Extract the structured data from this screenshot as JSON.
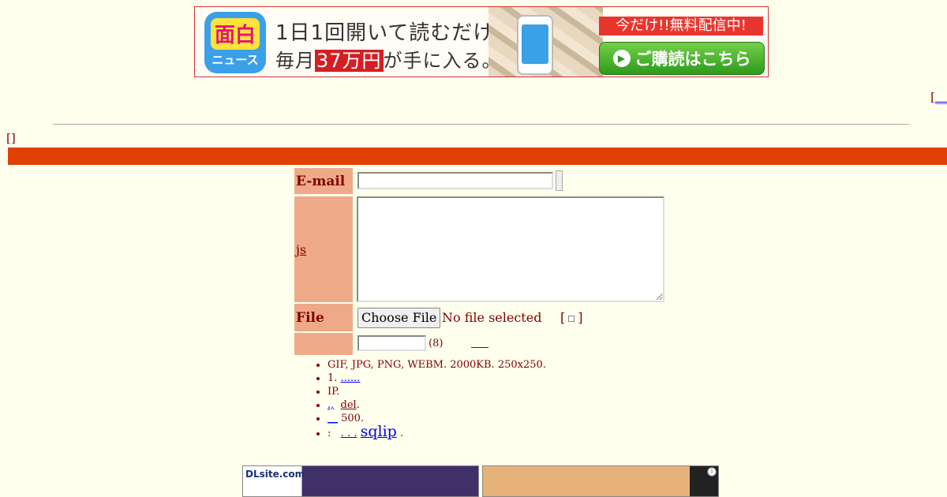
{
  "banner": {
    "app_icon_title": "面白",
    "app_icon_sub": "ニュース",
    "line1": "1日1回開いて読むだけ。",
    "line2_prefix": "毎月",
    "line2_highlight": "37万円",
    "line2_suffix": "が手に入る。",
    "promo": "今だけ!!無料配信中!",
    "cta_label": "ご購読はこちら"
  },
  "corner_nav": {
    "bracket": "[",
    "link": "__"
  },
  "mini_bracket": "[]",
  "colors": {
    "title_bar": "#e04000",
    "label_bg": "#eeaa88",
    "page_bg": "#ffffee",
    "text": "#800000"
  },
  "form": {
    "email_label": "E-mail",
    "js_label": "js",
    "file_label": "File",
    "file_button": "Choose File",
    "file_status": "No file selected",
    "file_option_left": "[",
    "file_option_right": "]",
    "pass_note": "(8)"
  },
  "rules": [
    "GIF, JPG, PNG, WEBM. 2000KB. 250x250.",
    "1.",
    "IP.",
    ".,",
    "500.",
    ":"
  ],
  "rule_links": {
    "r2_dots": "......",
    "r4_del": "del",
    "r5_link": "__",
    "r6_sqlip": "sqlip",
    "r6_dots": ". . ."
  },
  "ads": {
    "ad1_brand": "DLsite.com",
    "ad2_info": "i"
  }
}
